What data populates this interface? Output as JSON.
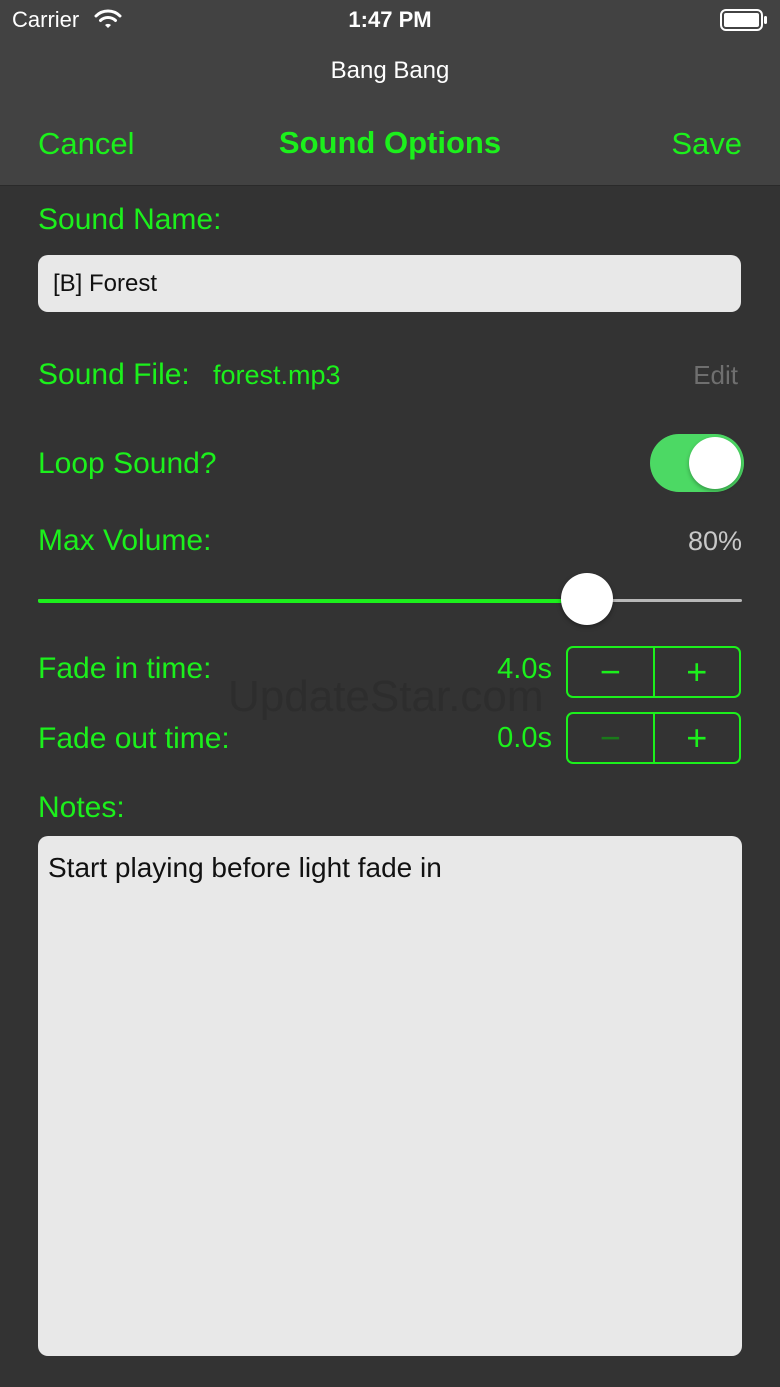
{
  "status_bar": {
    "carrier": "Carrier",
    "time": "1:47 PM"
  },
  "nav": {
    "subtitle": "Bang Bang",
    "cancel": "Cancel",
    "title": "Sound Options",
    "save": "Save"
  },
  "sound_name": {
    "label": "Sound Name:",
    "value": "[B] Forest"
  },
  "sound_file": {
    "label": "Sound File:",
    "value": "forest.mp3",
    "edit": "Edit"
  },
  "loop": {
    "label": "Loop Sound?",
    "on": true
  },
  "volume": {
    "label": "Max Volume:",
    "display": "80%",
    "fraction": 0.78
  },
  "fade_in": {
    "label": "Fade in time:",
    "value": "4.0s",
    "minus": "−",
    "plus": "+"
  },
  "fade_out": {
    "label": "Fade out time:",
    "value": "0.0s",
    "minus": "−",
    "plus": "+"
  },
  "notes": {
    "label": "Notes:",
    "value": "Start playing before light fade in"
  },
  "watermark": "UpdateStar.com",
  "colors": {
    "accent": "#1cf01c",
    "background": "#333333",
    "bar": "#424242",
    "toggle_on": "#4cd964"
  },
  "icons": [
    "wifi-icon",
    "battery-icon"
  ]
}
